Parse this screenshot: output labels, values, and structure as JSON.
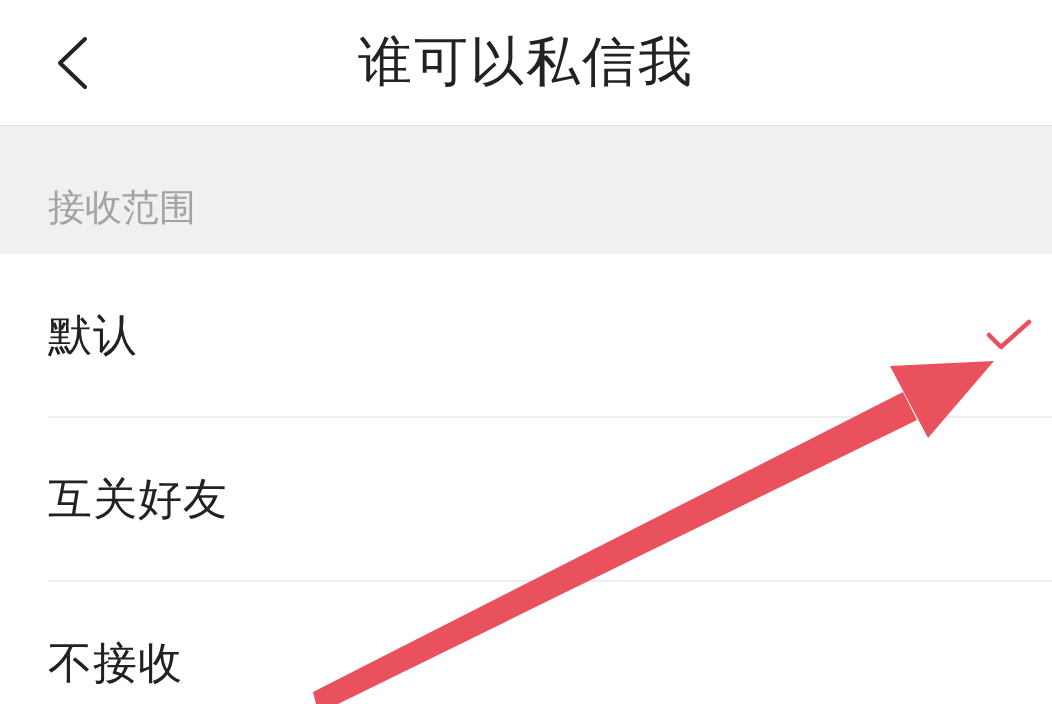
{
  "header": {
    "title": "谁可以私信我"
  },
  "section": {
    "title": "接收范围"
  },
  "options": [
    {
      "label": "默认",
      "selected": true
    },
    {
      "label": "互关好友",
      "selected": false
    },
    {
      "label": "不接收",
      "selected": false
    }
  ]
}
